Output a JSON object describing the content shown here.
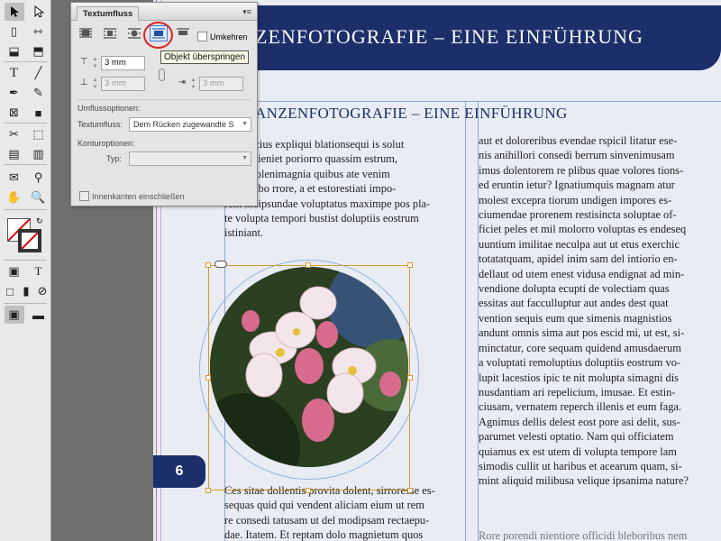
{
  "document": {
    "banner_title": "ZENFOTOGRAFIE – EINE EINFÜHRUNG",
    "heading": "ANZENFOTOGRAFIE – EINE EINFÜHRUNG",
    "page_number": "6",
    "col1_top": [
      "ate suscius expliqui blationsequi is solut",
      "ost as nieniet poriorro quassim estrum,",
      "abor molenimagnia quibus ate venim",
      "in nullabo rrore, a et estorestiati impo-",
      "rem incipsundae voluptatus maximpe pos pla-",
      "te volupta tempori bustist doluptiis eostrum",
      "istiniant."
    ],
    "col1_bottom": [
      "Ces sitae dollentis provita dolent, sirroresse es-",
      "sequas quid qui vendent aliciam eium ut rem",
      "re consedi tatusam ut del modipsam rectaepu-",
      "dae. Itatem. Et reptam dolo magnietum quos"
    ],
    "col2": [
      "aut et doloreribus evendae rspicil litatur ese-",
      "nis anihillori consedi berrum sinvenimusam",
      "imus dolentorem re plibus quae volores tions-",
      "ed eruntin ietur? Ignatiumquis magnam atur",
      "molest excepra tiorum undigen impores es-",
      "ciumendae prorenem restisincta soluptae of-",
      "ficiet peles et mil molorro voluptas es endeseq",
      "uuntium imilitae neculpa aut ut etus exerchic",
      "totatatquam, apidel inim sam del intiorio en-",
      "dellaut od utem enest vidusa endignat ad min-",
      "vendione dolupta ecupti de volectiam quas",
      "essitas aut facculluptur aut andes dest quat",
      "vention sequis eum que simenis magnistios",
      "andunt omnis sima aut pos escid mi, ut est, si-",
      "minctatur, core sequam quidend amusdaerum",
      "a voluptati remoluptius doluptiis eostrum vo-",
      "lupit lacestios ipic te nit molupta simagni dis",
      "nusdantiam ari repelicium, imusae. Et estin-",
      "ciusam, vernatem reperch illenis et eum faga.",
      "Agnimus dellis delest eost pore asi delit, sus-",
      "parumet velesti optatio. Nam qui officiatem",
      "quiamus ex est utem di volupta tempore lam",
      "simodis cullit ut haribus et acearum quam, si-",
      "mint aliquid milibusa velique ipsanima nature?"
    ],
    "col2_bottom": "Rore porendi nientiore officidi bleboribus nem"
  },
  "panel": {
    "tab_label": "Textumfluss",
    "menu_label": "▾≡",
    "invert_label": "Umkehren",
    "tooltip": "Objekt überspringen",
    "top_offset": "3 mm",
    "left_offset": "3 mm",
    "bottom_offset": "3 mm",
    "right_offset": "3 mm",
    "wrap_options_heading": "Umflussoptionen:",
    "wrap_to_label": "Textumfluss:",
    "wrap_to_value": "Dem Rücken zugewandte S",
    "contour_heading": "Konturoptionen:",
    "type_label": "Typ:",
    "type_value": "",
    "inner_edges_label": "Innenkanten einschließen"
  },
  "colors": {
    "accent_blue": "#1c2f6b",
    "highlight_red": "#dd2222",
    "frame_orange": "#d49a2a"
  }
}
